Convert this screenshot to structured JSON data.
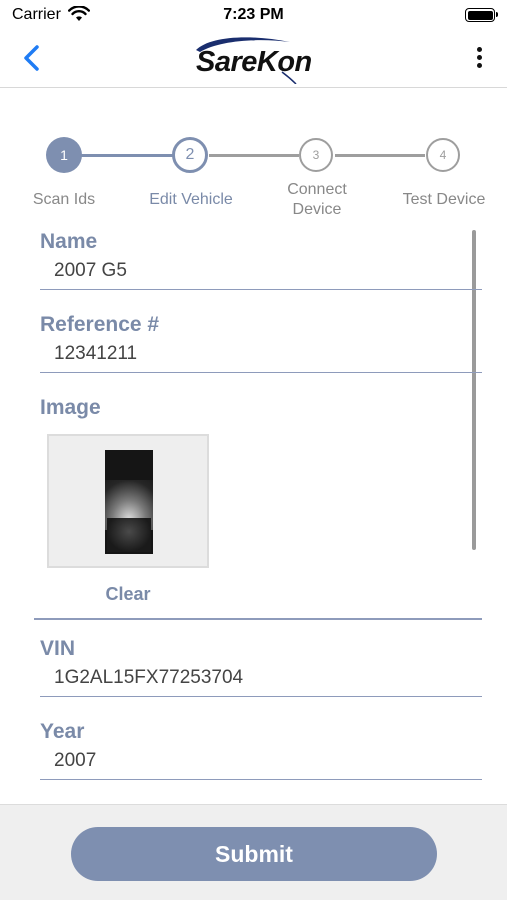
{
  "status_bar": {
    "carrier": "Carrier",
    "time": "7:23 PM",
    "wifi_icon": "wifi-icon",
    "battery_icon": "battery-icon"
  },
  "header": {
    "back_icon": "chevron-left-icon",
    "logo_text": "SareKon",
    "menu_icon": "more-vertical-icon"
  },
  "stepper": {
    "steps": [
      {
        "number": "1",
        "label": "Scan Ids",
        "state": "done"
      },
      {
        "number": "2",
        "label": "Edit Vehicle",
        "state": "current"
      },
      {
        "number": "3",
        "label": "Connect Device",
        "state": "pending"
      },
      {
        "number": "4",
        "label": "Test Device",
        "state": "pending"
      }
    ],
    "colors": {
      "done": "#7e8fb0",
      "current": "#7e8fb0",
      "pending": "#9e9e9e"
    }
  },
  "form": {
    "name": {
      "label": "Name",
      "value": "2007 G5"
    },
    "reference": {
      "label": "Reference #",
      "value": "12341211"
    },
    "image": {
      "label": "Image",
      "clear_label": "Clear"
    },
    "vin": {
      "label": "VIN",
      "value": "1G2AL15FX77253704"
    },
    "year": {
      "label": "Year",
      "value": "2007"
    }
  },
  "footer": {
    "submit_label": "Submit"
  },
  "colors": {
    "accent": "#7e8fb0",
    "back_blue": "#1f7cf4",
    "label": "#7a8aa8"
  }
}
